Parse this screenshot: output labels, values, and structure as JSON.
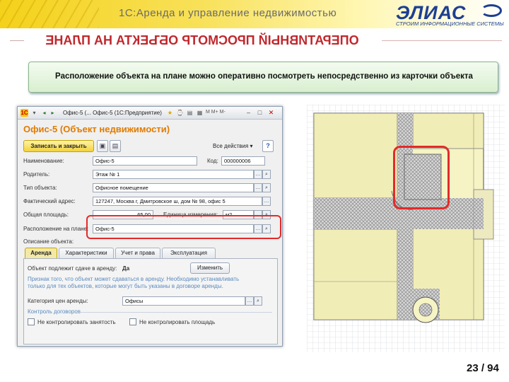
{
  "header": {
    "title": "1С:Аренда и управление недвижимостью",
    "logo_text": "ЭЛИАС",
    "logo_tagline": "СТРОИМ ИНФОРМАЦИОННЫЕ СИСТЕМЫ",
    "mirrored_heading": "ОПЕРАТИВНЫЙ ПРОСМОТР ОБЪЕКТА НА ПЛАНЕ"
  },
  "banner": {
    "text": "Расположение объекта на плане можно оперативно посмотреть непосредственно из карточки объекта"
  },
  "window": {
    "caption": "Офис-5 (... Офис-5 (1С:Предприятие)",
    "toolbar_icons": [
      "1c-logo-icon",
      "menu-icon",
      "back-icon",
      "forward-icon",
      "star-icon",
      "history-icon",
      "print-icon",
      "calc-icon",
      "calendar-icon",
      "memory-icon"
    ],
    "toolbar_text": "M  M+  M-",
    "form_title": "Офис-5 (Объект недвижимости)",
    "save_close": "Записать и закрыть",
    "all_actions": "Все действия ▾",
    "help": "?",
    "fields": {
      "name_label": "Наименование:",
      "name_value": "Офис-5",
      "code_label": "Код:",
      "code_value": "000000006",
      "parent_label": "Родитель:",
      "parent_value": "Этаж № 1",
      "type_label": "Тип объекта:",
      "type_value": "Офисное помещение",
      "address_label": "Фактический адрес:",
      "address_value": "127247, Москва г, Дмитровское ш, дом № 98, офис 5",
      "area_label": "Общая площадь:",
      "area_value": "65,00",
      "unit_label": "Единица измерения:",
      "unit_value": "м2",
      "plan_label": "Расположение на плане:",
      "plan_value": "Офис-5",
      "desc_label": "Описание объекта:"
    },
    "tabs": [
      "Аренда",
      "Характеристики",
      "Учет и права",
      "Эксплуатация"
    ],
    "rent": {
      "subject_label": "Объект подлежит сдаче в аренду:",
      "subject_value": "Да",
      "change_btn": "Изменить",
      "note": "Признак того, что объект может сдаваться в аренду. Необходимо устанавливать только для тех объектов, которые могут быть указаны в договоре аренды.",
      "category_label": "Категория цен аренды:",
      "category_value": "Офисы",
      "control_group": "Контроль договоров",
      "cb_occupancy": "Не контролировать занятость",
      "cb_area": "Не контролировать площадь"
    }
  },
  "page": {
    "current": "23",
    "total": "94",
    "label": "23 / 94"
  },
  "colors": {
    "accent_red": "#e32a2a",
    "form_title": "#e07b00",
    "plan_fill": "#f6f3c4"
  }
}
